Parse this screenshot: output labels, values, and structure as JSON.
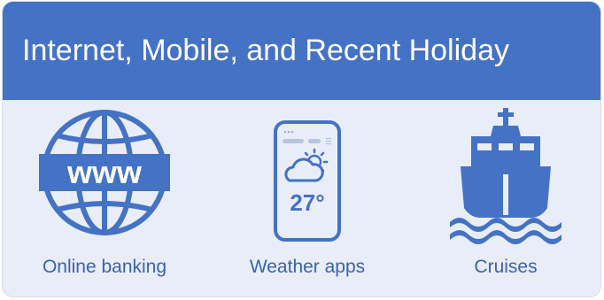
{
  "header": {
    "title": "Internet, Mobile, and Recent Holiday"
  },
  "colors": {
    "header_background": "#4472c4",
    "card_background": "#e8edf7",
    "icon_color": "#4472c4",
    "label_color": "#3a63ad",
    "title_color": "#ffffff"
  },
  "items": [
    {
      "icon": "globe-www-icon",
      "icon_text": "www",
      "label": "Online banking"
    },
    {
      "icon": "smartphone-weather-icon",
      "icon_text": "27°",
      "label": "Weather apps"
    },
    {
      "icon": "cruise-ship-icon",
      "label": "Cruises"
    }
  ]
}
